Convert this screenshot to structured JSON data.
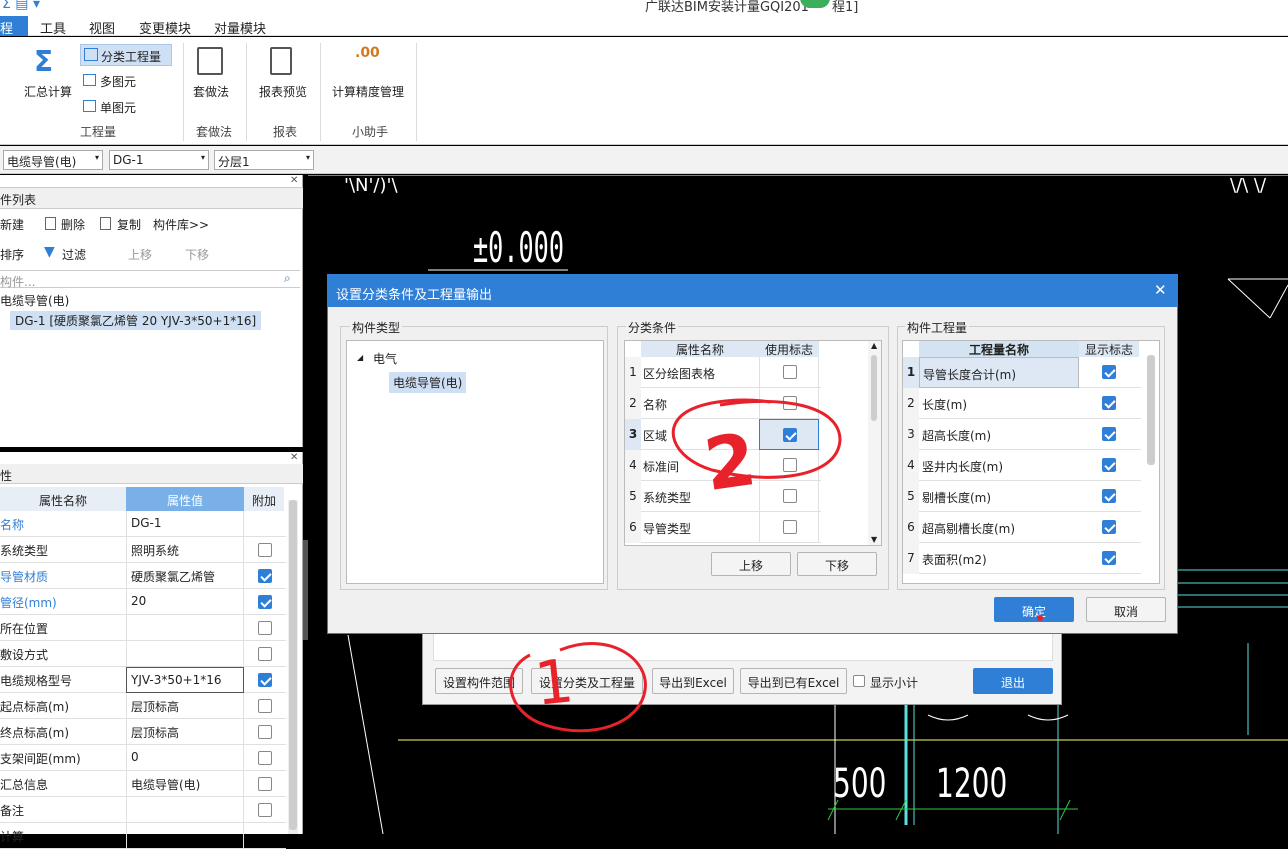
{
  "app": {
    "title": "广联达BIM安装计量GQI201",
    "title_suffix": "程1]"
  },
  "menu": {
    "items": [
      "程",
      "工具",
      "视图",
      "变更模块",
      "对量模块"
    ]
  },
  "ribbon": {
    "huizong": "汇总计算",
    "fenlei": "分类工程量",
    "duotuyuan": "多图元",
    "dantuyuan": "单图元",
    "group1": "工程量",
    "taozuofa": "套做法",
    "group2": "套做法",
    "baobiao": "报表预览",
    "group3": "报表",
    "jingdu": "计算精度管理",
    "jingdu_icon": ".00",
    "group4": "小助手"
  },
  "selectors": {
    "s1": "电缆导管(电)",
    "s2": "DG-1",
    "s3": "分层1"
  },
  "component_panel": {
    "title": "件列表",
    "new": "新建",
    "delete": "删除",
    "copy": "复制",
    "library": "构件库>>",
    "sort": "排序",
    "filter": "过滤",
    "up": "上移",
    "down": "下移",
    "search_placeholder": "构件...",
    "tree_root": "电缆导管(电)",
    "tree_child": "DG-1 [硬质聚氯乙烯管 20 YJV-3*50+1*16]"
  },
  "prop_panel": {
    "title": "性",
    "col_name": "属性名称",
    "col_value": "属性值",
    "col_extra": "附加",
    "rows": [
      {
        "name": "名称",
        "value": "DG-1",
        "blue": true
      },
      {
        "name": "系统类型",
        "value": "照明系统",
        "blue": false
      },
      {
        "name": "导管材质",
        "value": "硬质聚氯乙烯管",
        "blue": true
      },
      {
        "name": "管径(mm)",
        "value": "20",
        "blue": true
      },
      {
        "name": "所在位置",
        "value": "",
        "blue": false
      },
      {
        "name": "敷设方式",
        "value": "",
        "blue": false
      },
      {
        "name": "电缆规格型号",
        "value": "YJV-3*50+1*16",
        "blue": false
      },
      {
        "name": "起点标高(m)",
        "value": "层顶标高",
        "blue": false
      },
      {
        "name": "终点标高(m)",
        "value": "层顶标高",
        "blue": false
      },
      {
        "name": "支架间距(mm)",
        "value": "0",
        "blue": false
      },
      {
        "name": "汇总信息",
        "value": "电缆导管(电)",
        "blue": false
      },
      {
        "name": "备注",
        "value": "",
        "blue": false
      },
      {
        "name": "计算",
        "value": "",
        "blue": false
      }
    ],
    "checks": [
      null,
      false,
      true,
      true,
      false,
      false,
      true,
      false,
      false,
      false,
      false,
      false
    ]
  },
  "cad": {
    "elev": "±0.000",
    "dim1": "500",
    "dim2": "1200",
    "t1": "'\\N'/)'\\",
    "t2": "\\/\\ \\/"
  },
  "dialog": {
    "title": "设置分类条件及工程量输出",
    "sec1": "构件类型",
    "tree_root": "电气",
    "tree_child": "电缆导管(电)",
    "sec2": "分类条件",
    "col_attr": "属性名称",
    "col_use": "使用标志",
    "cond_rows": [
      {
        "n": "1",
        "name": "区分绘图表格",
        "on": false
      },
      {
        "n": "2",
        "name": "名称",
        "on": false
      },
      {
        "n": "3",
        "name": "区域",
        "on": true
      },
      {
        "n": "4",
        "name": "标准间",
        "on": false
      },
      {
        "n": "5",
        "name": "系统类型",
        "on": false
      },
      {
        "n": "6",
        "name": "导管类型",
        "on": false
      }
    ],
    "up": "上移",
    "down": "下移",
    "sec3": "构件工程量",
    "col_qty": "工程量名称",
    "col_show": "显示标志",
    "qty_rows": [
      {
        "n": "1",
        "name": "导管长度合计(m)"
      },
      {
        "n": "2",
        "name": "长度(m)"
      },
      {
        "n": "3",
        "name": "超高长度(m)"
      },
      {
        "n": "4",
        "name": "竖井内长度(m)"
      },
      {
        "n": "5",
        "name": "剔槽长度(m)"
      },
      {
        "n": "6",
        "name": "超高剔槽长度(m)"
      },
      {
        "n": "7",
        "name": "表面积(m2)"
      }
    ],
    "ok": "确定",
    "cancel": "取消"
  },
  "bottom_bar": {
    "b1": "设置构件范围",
    "b2": "设置分类及工程量",
    "b3": "导出到Excel",
    "b4": "导出到已有Excel",
    "show_sub": "显示小计",
    "exit": "退出"
  },
  "annotations": {
    "mark1": "1",
    "mark2": "2",
    "color": "#e8222a"
  },
  "colors": {
    "accent": "#2f7fd6",
    "header": "#dde8f4",
    "cad_bg": "#000000"
  }
}
